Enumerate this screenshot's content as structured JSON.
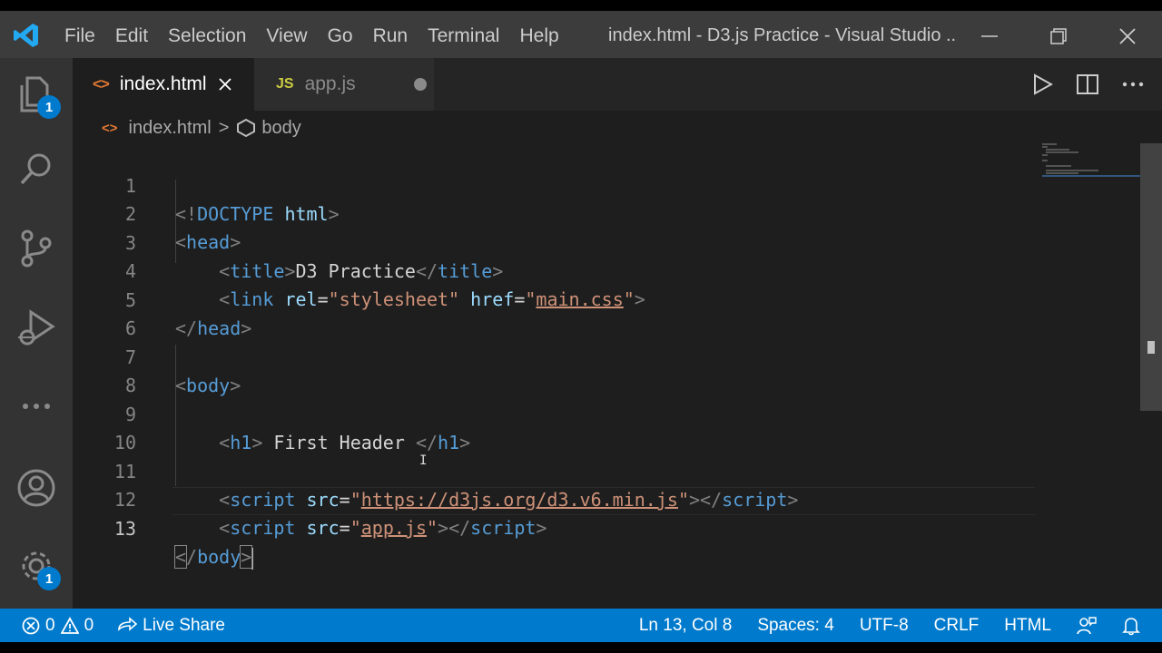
{
  "titlebar": {
    "menu": [
      "File",
      "Edit",
      "Selection",
      "View",
      "Go",
      "Run",
      "Terminal",
      "Help"
    ],
    "window_title": "index.html - D3.js Practice - Visual Studio ..."
  },
  "activity": {
    "explorer_badge": "1",
    "manage_badge": "1"
  },
  "tabs": [
    {
      "label": "index.html",
      "icon": "<>",
      "state": "active"
    },
    {
      "label": "app.js",
      "icon": "JS",
      "state": "modified"
    }
  ],
  "breadcrumb": {
    "file": "index.html",
    "separator": ">",
    "symbol": "body"
  },
  "editor": {
    "current_line": 13,
    "lines": [
      {
        "n": "1"
      },
      {
        "n": "2"
      },
      {
        "n": "3"
      },
      {
        "n": "4"
      },
      {
        "n": "5"
      },
      {
        "n": "6"
      },
      {
        "n": "7"
      },
      {
        "n": "8"
      },
      {
        "n": "9"
      },
      {
        "n": "10"
      },
      {
        "n": "11"
      },
      {
        "n": "12"
      },
      {
        "n": "13"
      }
    ],
    "tokens": {
      "doctype_open": "<!",
      "doctype": "DOCTYPE",
      "html": "html",
      "head": "head",
      "title": "title",
      "title_text": "D3 Practice",
      "link": "link",
      "rel": "rel",
      "rel_val": "\"stylesheet\"",
      "href": "href",
      "href_val": "main.css",
      "body": "body",
      "h1": "h1",
      "h1_text": " First Header ",
      "script": "script",
      "src": "src",
      "d3_src": "https://d3js.org/d3.v6.min.js",
      "app_src": "app.js",
      "quote": "\"",
      "eq": "="
    }
  },
  "statusbar": {
    "errors": "0",
    "warnings": "0",
    "live_share": "Live Share",
    "position": "Ln 13, Col 8",
    "spaces": "Spaces: 4",
    "encoding": "UTF-8",
    "eol": "CRLF",
    "language": "HTML"
  },
  "colors": {
    "accent": "#007acc",
    "tag": "#569cd6",
    "attr": "#9cdcfe",
    "string": "#ce9178"
  }
}
